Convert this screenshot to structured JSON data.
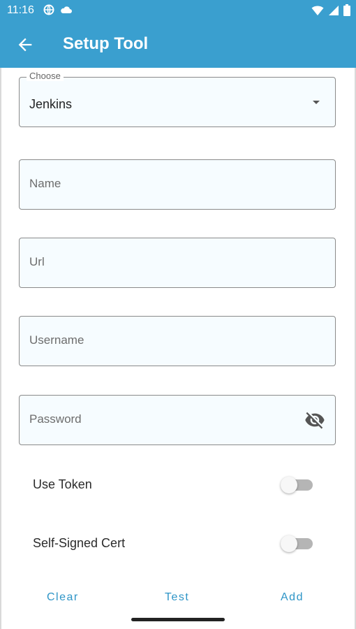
{
  "status_bar": {
    "time": "11:16"
  },
  "app_bar": {
    "title": "Setup Tool",
    "back_icon": "arrow-back-icon"
  },
  "form": {
    "choose": {
      "label": "Choose",
      "value": "Jenkins"
    },
    "name": {
      "placeholder": "Name"
    },
    "url": {
      "placeholder": "Url"
    },
    "username": {
      "placeholder": "Username"
    },
    "password": {
      "placeholder": "Password",
      "icon": "visibility-off-icon"
    },
    "use_token": {
      "label": "Use Token",
      "enabled": false
    },
    "self_signed": {
      "label": "Self-Signed Cert",
      "enabled": false
    }
  },
  "actions": {
    "clear": "Clear",
    "test": "Test",
    "add": "Add"
  },
  "colors": {
    "accent": "#3a9fcf",
    "action_text": "#2e95c7",
    "field_bg": "#f6fcff"
  }
}
